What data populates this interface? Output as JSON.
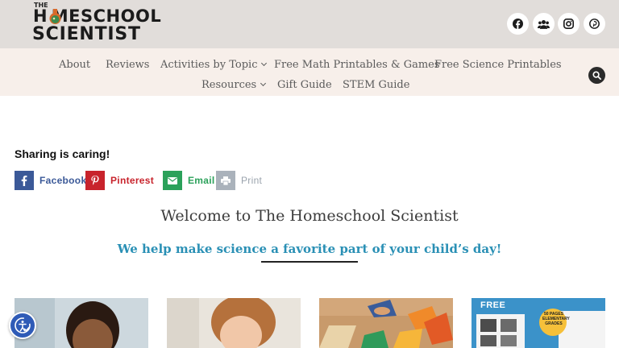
{
  "logo": {
    "the": "THE",
    "line1": "H MESCHOOL",
    "line2": "SCIENTIST"
  },
  "social": [
    "facebook-icon",
    "group-icon",
    "instagram-icon",
    "pinterest-icon"
  ],
  "nav": {
    "row1": [
      {
        "label": "About"
      },
      {
        "label": "Reviews"
      },
      {
        "label": "Activities by Topic",
        "dropdown": true
      },
      {
        "label": "Free Math Printables & Games"
      },
      {
        "label": "Free Science Printables"
      }
    ],
    "row2": [
      {
        "label": "Resources",
        "dropdown": true
      },
      {
        "label": "Gift Guide"
      },
      {
        "label": "STEM Guide"
      }
    ]
  },
  "sharing": {
    "title": "Sharing is caring!",
    "buttons": [
      {
        "label": "Facebook",
        "icon": "facebook-icon",
        "color": "#3b5998"
      },
      {
        "label": "Pinterest",
        "icon": "pinterest-icon",
        "color": "#c8232c"
      },
      {
        "label": "Email",
        "icon": "email-icon",
        "color": "#2ba15a"
      },
      {
        "label": "Print",
        "icon": "print-icon",
        "color": "#9aa3ad"
      }
    ]
  },
  "welcome": "Welcome to The Homeschool Scientist",
  "tagline": "We help make science a favorite part of your child’s day!",
  "cards": [
    {
      "name": "card-boy"
    },
    {
      "name": "card-girl-writing"
    },
    {
      "name": "card-tangram"
    },
    {
      "name": "card-free-printable",
      "badge": "FREE",
      "sticker": "50 PAGES ELEMENTARY GRADES"
    }
  ],
  "colors": {
    "header_bg": "#e1ddda",
    "nav_bg": "#f7efea",
    "accent": "#2a90b5"
  }
}
